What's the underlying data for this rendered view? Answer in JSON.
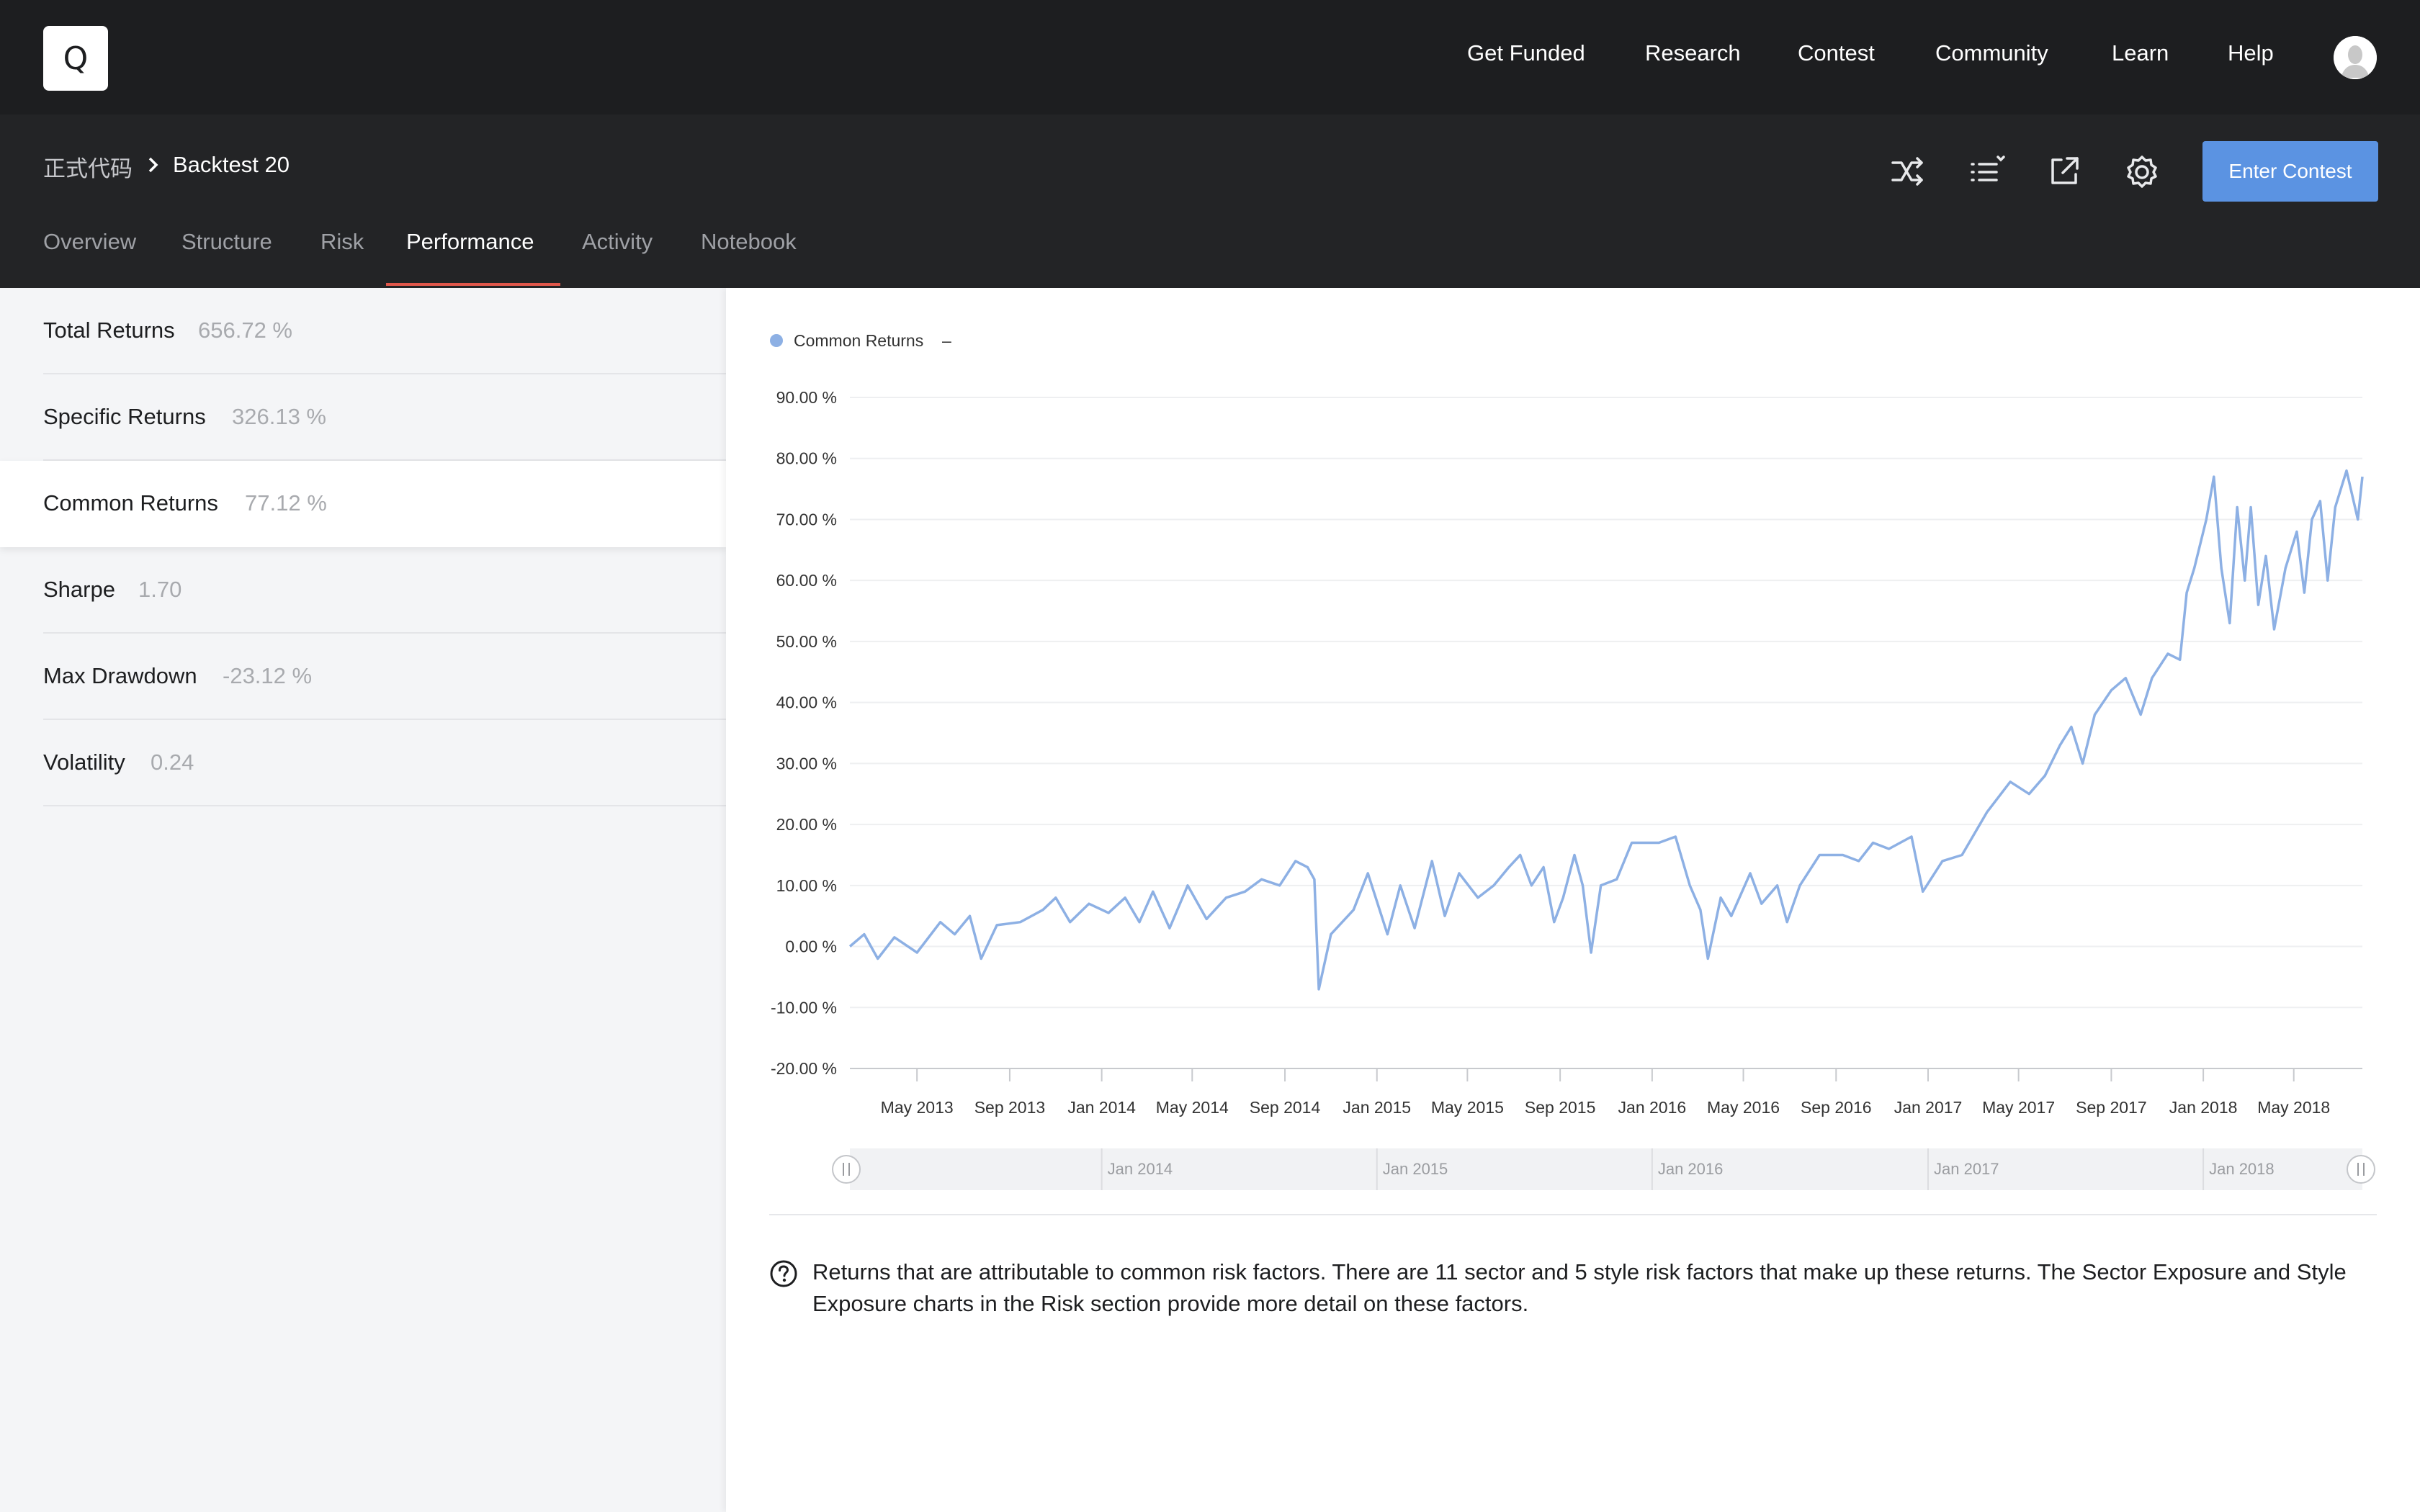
{
  "app": {
    "logo_letter": "Q",
    "nav": [
      "Get Funded",
      "Research",
      "Contest",
      "Community",
      "Learn",
      "Help"
    ]
  },
  "breadcrumb": {
    "root": "正式代码",
    "current": "Backtest 20"
  },
  "toolbar": {
    "icons": [
      "shuffle-icon",
      "list-icon",
      "external-link-icon",
      "gear-icon"
    ],
    "enter_contest": "Enter Contest"
  },
  "tabs": [
    {
      "label": "Overview",
      "active": false
    },
    {
      "label": "Structure",
      "active": false
    },
    {
      "label": "Risk",
      "active": false
    },
    {
      "label": "Performance",
      "active": true
    },
    {
      "label": "Activity",
      "active": false
    },
    {
      "label": "Notebook",
      "active": false
    }
  ],
  "metrics": [
    {
      "label": "Total Returns",
      "value": "656.72 %",
      "active": false
    },
    {
      "label": "Specific Returns",
      "value": "326.13 %",
      "active": false
    },
    {
      "label": "Common Returns",
      "value": "77.12 %",
      "active": true
    },
    {
      "label": "Sharpe",
      "value": "1.70",
      "active": false
    },
    {
      "label": "Max Drawdown",
      "value": "-23.12 %",
      "active": false
    },
    {
      "label": "Volatility",
      "value": "0.24",
      "active": false
    }
  ],
  "description": "Returns that are attributable to common risk factors. There are 11 sector and 5 style risk factors that make up these returns. The Sector Exposure and Style Exposure charts in the Risk section provide more detail on these factors.",
  "colors": {
    "series": "#8db0e4",
    "accent": "#5b93e2",
    "tab_underline": "#e0574b",
    "topbar": "#1d1e20",
    "subheader": "#232426"
  },
  "chart_data": {
    "type": "line",
    "legend": {
      "series": "Common Returns",
      "value": "–",
      "position": "top-left"
    },
    "ylim": [
      -20,
      90
    ],
    "yticks": [
      90,
      80,
      70,
      60,
      50,
      40,
      30,
      20,
      10,
      0,
      -10,
      -20
    ],
    "ytick_labels": [
      "90.00 %",
      "80.00 %",
      "70.00 %",
      "60.00 %",
      "50.00 %",
      "40.00 %",
      "30.00 %",
      "20.00 %",
      "10.00 %",
      "0.00 %",
      "-10.00 %",
      "-20.00 %"
    ],
    "xlim": [
      "2013-02-01",
      "2018-07-31"
    ],
    "xticks": [
      "2013-05-01",
      "2013-09-01",
      "2014-01-01",
      "2014-05-01",
      "2014-09-01",
      "2015-01-01",
      "2015-05-01",
      "2015-09-01",
      "2016-01-01",
      "2016-05-01",
      "2016-09-01",
      "2017-01-01",
      "2017-05-01",
      "2017-09-01",
      "2018-01-01",
      "2018-05-01"
    ],
    "xtick_labels": [
      "May 2013",
      "Sep 2013",
      "Jan 2014",
      "May 2014",
      "Sep 2014",
      "Jan 2015",
      "May 2015",
      "Sep 2015",
      "Jan 2016",
      "May 2016",
      "Sep 2016",
      "Jan 2017",
      "May 2017",
      "Sep 2017",
      "Jan 2018",
      "May 2018"
    ],
    "grid": true,
    "navigator": {
      "labels": [
        "Jan 2014",
        "Jan 2015",
        "Jan 2016",
        "Jan 2017",
        "Jan 2018"
      ],
      "dates": [
        "2014-01-01",
        "2015-01-01",
        "2016-01-01",
        "2017-01-01",
        "2018-01-01"
      ]
    },
    "series": [
      {
        "name": "Common Returns",
        "points": [
          [
            "2013-02-01",
            0.0
          ],
          [
            "2013-02-20",
            2.0
          ],
          [
            "2013-03-10",
            -2.0
          ],
          [
            "2013-04-01",
            1.5
          ],
          [
            "2013-05-01",
            -1.0
          ],
          [
            "2013-06-01",
            4.0
          ],
          [
            "2013-06-20",
            2.0
          ],
          [
            "2013-07-10",
            5.0
          ],
          [
            "2013-07-25",
            -2.0
          ],
          [
            "2013-08-15",
            3.5
          ],
          [
            "2013-09-15",
            4.0
          ],
          [
            "2013-10-15",
            6.0
          ],
          [
            "2013-11-01",
            8.0
          ],
          [
            "2013-11-20",
            4.0
          ],
          [
            "2013-12-15",
            7.0
          ],
          [
            "2014-01-10",
            5.5
          ],
          [
            "2014-02-01",
            8.0
          ],
          [
            "2014-02-20",
            4.0
          ],
          [
            "2014-03-10",
            9.0
          ],
          [
            "2014-04-01",
            3.0
          ],
          [
            "2014-04-25",
            10.0
          ],
          [
            "2014-05-20",
            4.5
          ],
          [
            "2014-06-15",
            8.0
          ],
          [
            "2014-07-10",
            9.0
          ],
          [
            "2014-08-01",
            11.0
          ],
          [
            "2014-08-25",
            10.0
          ],
          [
            "2014-09-15",
            14.0
          ],
          [
            "2014-10-01",
            13.0
          ],
          [
            "2014-10-10",
            11.0
          ],
          [
            "2014-10-16",
            -7.0
          ],
          [
            "2014-11-01",
            2.0
          ],
          [
            "2014-12-01",
            6.0
          ],
          [
            "2014-12-20",
            12.0
          ],
          [
            "2015-01-15",
            2.0
          ],
          [
            "2015-02-01",
            10.0
          ],
          [
            "2015-02-20",
            3.0
          ],
          [
            "2015-03-15",
            14.0
          ],
          [
            "2015-04-01",
            5.0
          ],
          [
            "2015-04-20",
            12.0
          ],
          [
            "2015-05-15",
            8.0
          ],
          [
            "2015-06-05",
            10.0
          ],
          [
            "2015-06-25",
            13.0
          ],
          [
            "2015-07-10",
            15.0
          ],
          [
            "2015-07-25",
            10.0
          ],
          [
            "2015-08-10",
            13.0
          ],
          [
            "2015-08-24",
            4.0
          ],
          [
            "2015-09-05",
            8.0
          ],
          [
            "2015-09-20",
            15.0
          ],
          [
            "2015-10-01",
            10.0
          ],
          [
            "2015-10-12",
            -1.0
          ],
          [
            "2015-10-25",
            10.0
          ],
          [
            "2015-11-15",
            11.0
          ],
          [
            "2015-12-05",
            17.0
          ],
          [
            "2016-01-10",
            17.0
          ],
          [
            "2016-02-01",
            18.0
          ],
          [
            "2016-02-20",
            10.0
          ],
          [
            "2016-03-05",
            6.0
          ],
          [
            "2016-03-15",
            -2.0
          ],
          [
            "2016-04-01",
            8.0
          ],
          [
            "2016-04-15",
            5.0
          ],
          [
            "2016-05-10",
            12.0
          ],
          [
            "2016-05-25",
            7.0
          ],
          [
            "2016-06-15",
            10.0
          ],
          [
            "2016-06-28",
            4.0
          ],
          [
            "2016-07-15",
            10.0
          ],
          [
            "2016-08-10",
            15.0
          ],
          [
            "2016-09-10",
            15.0
          ],
          [
            "2016-10-01",
            14.0
          ],
          [
            "2016-10-20",
            17.0
          ],
          [
            "2016-11-10",
            16.0
          ],
          [
            "2016-12-10",
            18.0
          ],
          [
            "2016-12-25",
            9.0
          ],
          [
            "2017-01-20",
            14.0
          ],
          [
            "2017-02-15",
            15.0
          ],
          [
            "2017-03-20",
            22.0
          ],
          [
            "2017-04-20",
            27.0
          ],
          [
            "2017-05-15",
            25.0
          ],
          [
            "2017-06-05",
            28.0
          ],
          [
            "2017-06-25",
            33.0
          ],
          [
            "2017-07-10",
            36.0
          ],
          [
            "2017-07-25",
            30.0
          ],
          [
            "2017-08-10",
            38.0
          ],
          [
            "2017-09-01",
            42.0
          ],
          [
            "2017-09-20",
            44.0
          ],
          [
            "2017-10-10",
            38.0
          ],
          [
            "2017-10-25",
            44.0
          ],
          [
            "2017-11-15",
            48.0
          ],
          [
            "2017-12-01",
            47.0
          ],
          [
            "2017-12-10",
            58.0
          ],
          [
            "2017-12-20",
            62.0
          ],
          [
            "2018-01-05",
            70.0
          ],
          [
            "2018-01-15",
            77.0
          ],
          [
            "2018-01-25",
            62.0
          ],
          [
            "2018-02-05",
            53.0
          ],
          [
            "2018-02-15",
            72.0
          ],
          [
            "2018-02-25",
            60.0
          ],
          [
            "2018-03-05",
            72.0
          ],
          [
            "2018-03-15",
            56.0
          ],
          [
            "2018-03-25",
            64.0
          ],
          [
            "2018-04-05",
            52.0
          ],
          [
            "2018-04-20",
            62.0
          ],
          [
            "2018-05-05",
            68.0
          ],
          [
            "2018-05-15",
            58.0
          ],
          [
            "2018-05-25",
            70.0
          ],
          [
            "2018-06-05",
            73.0
          ],
          [
            "2018-06-15",
            60.0
          ],
          [
            "2018-06-25",
            72.0
          ],
          [
            "2018-07-10",
            78.0
          ],
          [
            "2018-07-25",
            70.0
          ],
          [
            "2018-07-31",
            77.0
          ]
        ]
      }
    ]
  }
}
